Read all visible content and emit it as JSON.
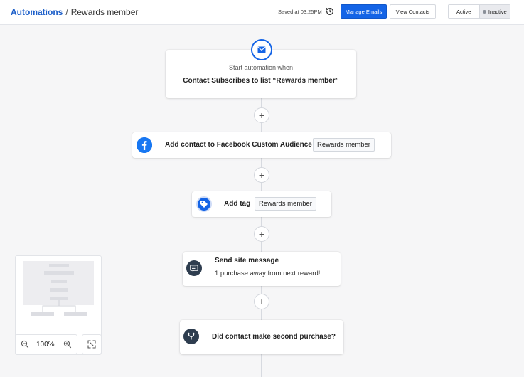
{
  "header": {
    "breadcrumb_root": "Automations",
    "breadcrumb_sep": "/",
    "breadcrumb_current": "Rewards member",
    "saved_text": "Saved at 03:25PM",
    "manage_emails_label": "Manage Emails",
    "view_contacts_label": "View Contacts",
    "status_toggle": {
      "options": [
        "Active",
        "Inactive"
      ],
      "selected": "Inactive"
    }
  },
  "workflow": {
    "trigger": {
      "subtitle": "Start automation when",
      "title": "Contact Subscribes to list “Rewards member”",
      "icon": "envelope-icon"
    },
    "steps": [
      {
        "title": "Add contact to Facebook Custom Audience",
        "value": "Rewards member",
        "icon": "facebook-icon"
      },
      {
        "title": "Add tag",
        "value": "Rewards member",
        "icon": "tag-icon"
      },
      {
        "title": "Send site message",
        "subtitle": "1 purchase away from next reward!",
        "icon": "site-message-icon"
      },
      {
        "title": "Did contact make second purchase?",
        "icon": "branch-icon"
      }
    ],
    "add_step_glyph": "+"
  },
  "zoom": {
    "value": "100%"
  },
  "colors": {
    "accent": "#1464e6",
    "facebook": "#1877f2",
    "dark_icon": "#2e3d4f"
  }
}
